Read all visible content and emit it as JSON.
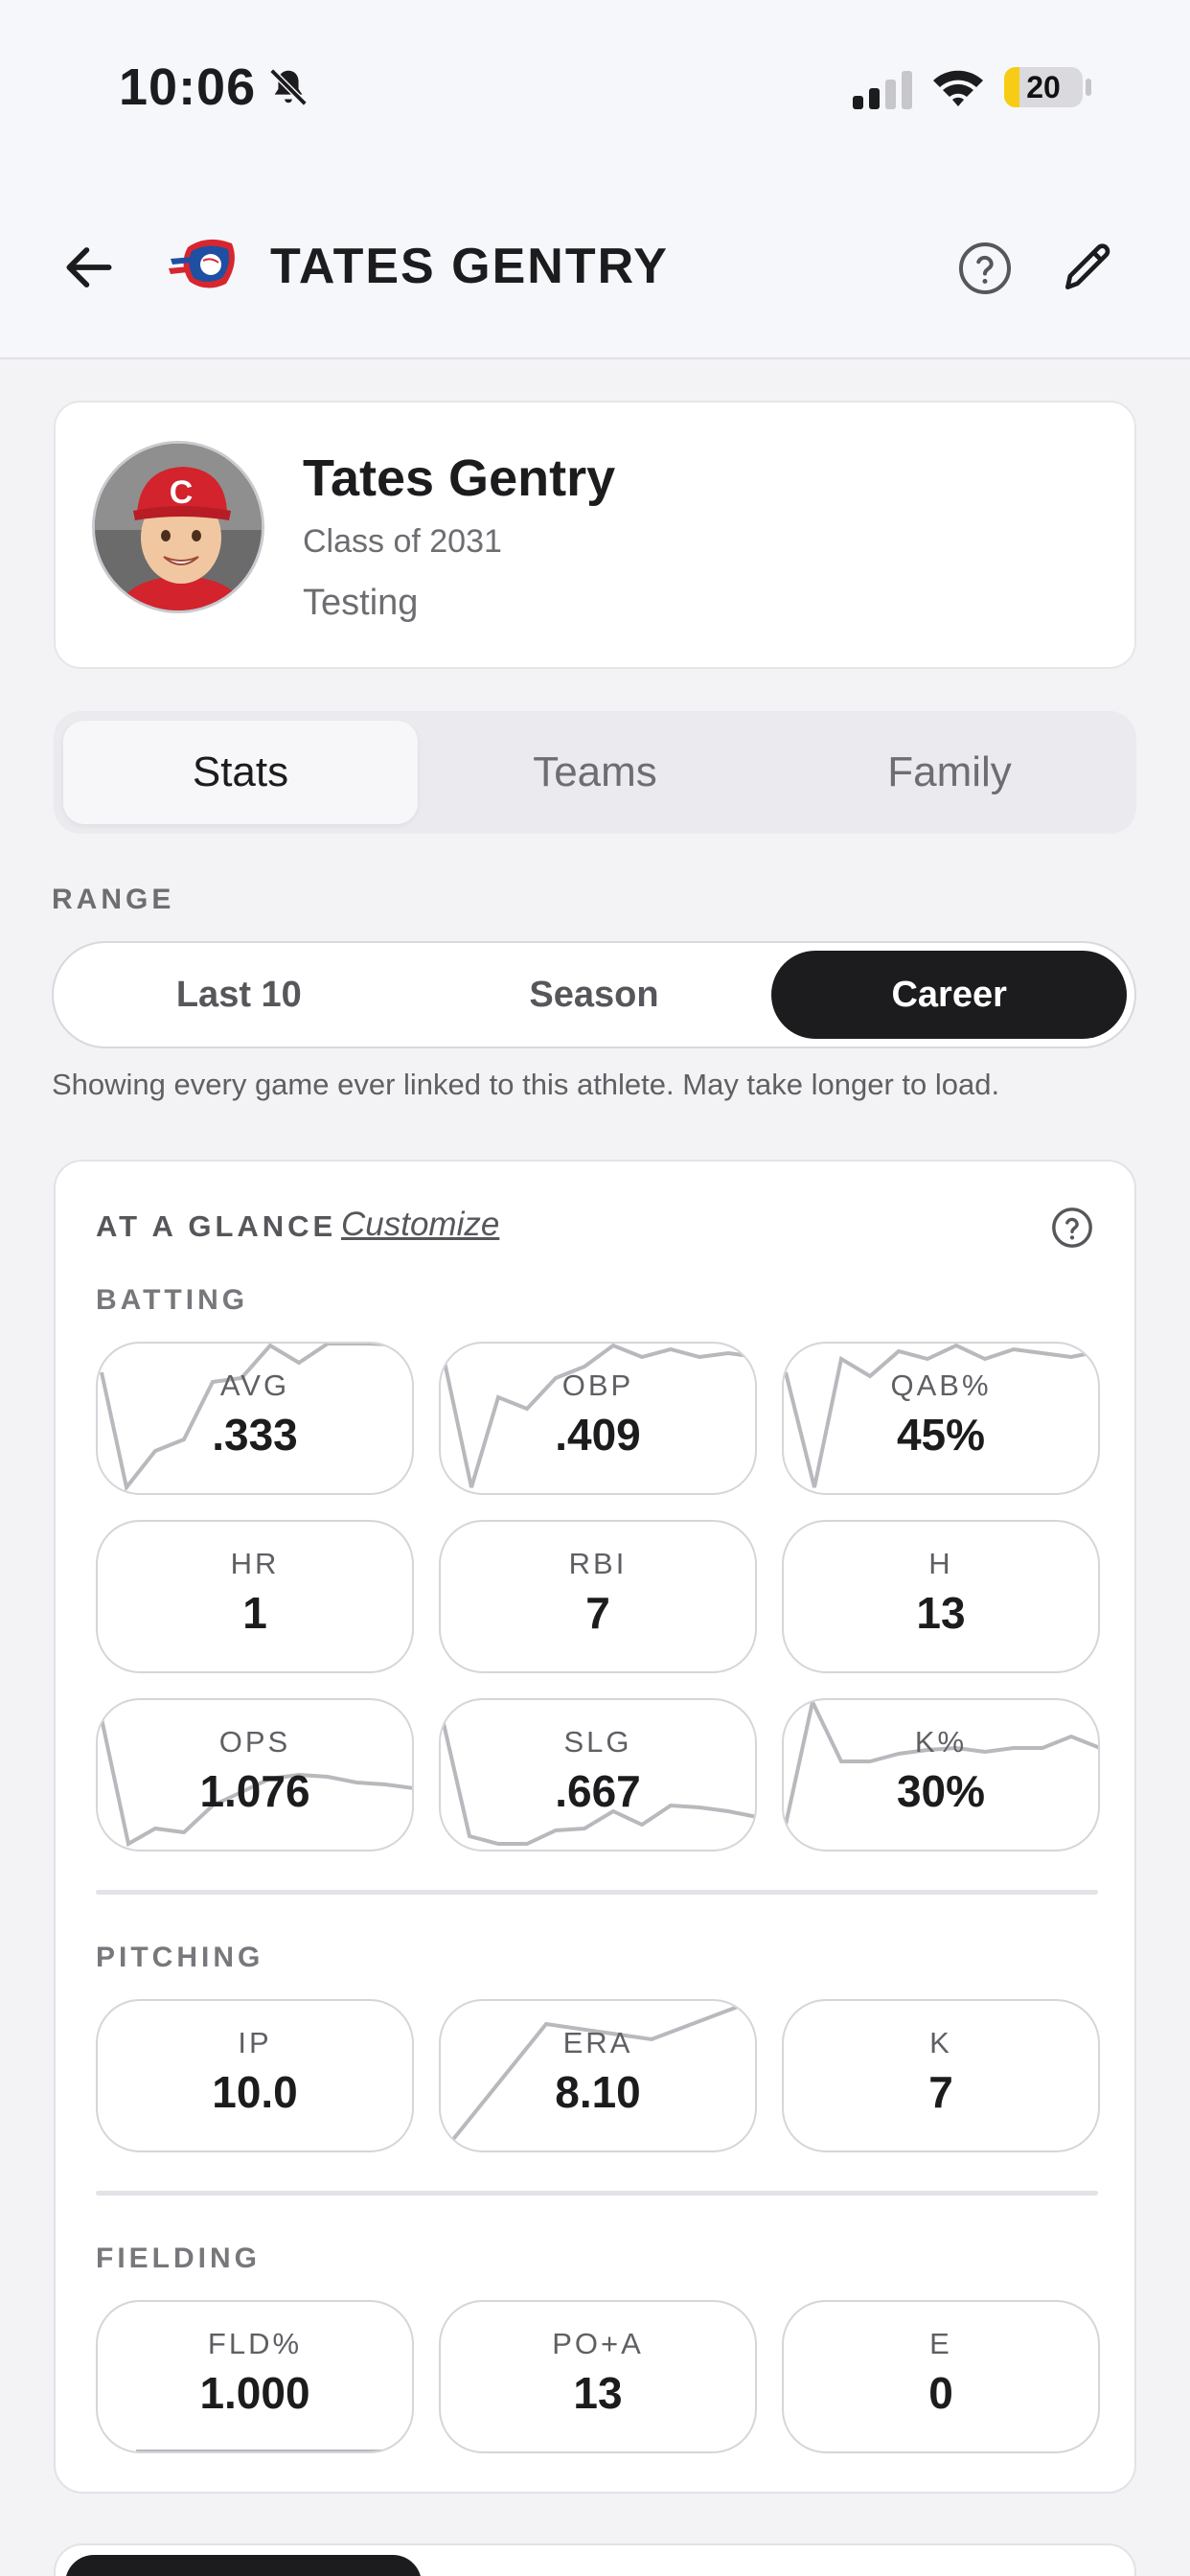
{
  "status_bar": {
    "time": "10:06",
    "battery": "20",
    "battery_level": 0.2
  },
  "header": {
    "title": "TATES GENTRY"
  },
  "profile": {
    "name": "Tates Gentry",
    "class_year": "Class of 2031",
    "team": "Testing"
  },
  "tabs": [
    {
      "label": "Stats",
      "active": true
    },
    {
      "label": "Teams",
      "active": false
    },
    {
      "label": "Family",
      "active": false
    }
  ],
  "range": {
    "label": "RANGE",
    "options": [
      {
        "label": "Last 10",
        "active": false
      },
      {
        "label": "Season",
        "active": false
      },
      {
        "label": "Career",
        "active": true
      }
    ],
    "note": "Showing every game ever linked to this athlete. May take longer to load."
  },
  "glance": {
    "title": "AT A GLANCE",
    "customize": "Customize",
    "sections": [
      {
        "label": "BATTING",
        "stats": [
          {
            "label": "AVG",
            "value": ".333"
          },
          {
            "label": "OBP",
            "value": ".409"
          },
          {
            "label": "QAB%",
            "value": "45%"
          },
          {
            "label": "HR",
            "value": "1"
          },
          {
            "label": "RBI",
            "value": "7"
          },
          {
            "label": "H",
            "value": "13"
          },
          {
            "label": "OPS",
            "value": "1.076"
          },
          {
            "label": "SLG",
            "value": ".667"
          },
          {
            "label": "K%",
            "value": "30%"
          }
        ]
      },
      {
        "label": "PITCHING",
        "stats": [
          {
            "label": "IP",
            "value": "10.0"
          },
          {
            "label": "ERA",
            "value": "8.10"
          },
          {
            "label": "K",
            "value": "7"
          }
        ]
      },
      {
        "label": "FIELDING",
        "stats": [
          {
            "label": "FLD%",
            "value": "1.000"
          },
          {
            "label": "PO+A",
            "value": "13"
          },
          {
            "label": "E",
            "value": "0"
          }
        ]
      }
    ]
  },
  "colors": {
    "accent_dark": "#1c1c1f",
    "muted_text": "#6d6d72",
    "sparkline": "#b8b8bd",
    "battery": "#f7cc15"
  }
}
